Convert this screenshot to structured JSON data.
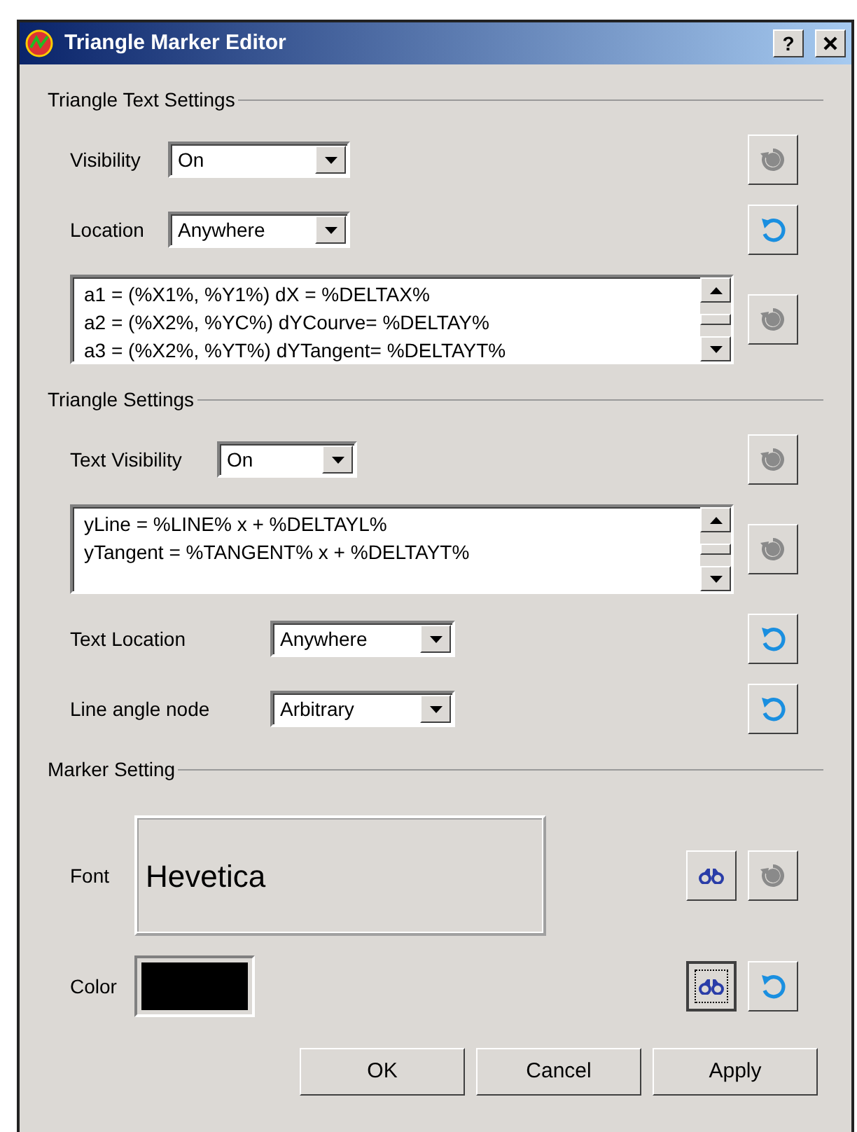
{
  "window": {
    "title": "Triangle Marker Editor",
    "help_label": "?"
  },
  "sections": [
    {
      "title": "Triangle Text Settings",
      "rows": [
        {
          "kind": "select",
          "label": "Visibility",
          "value": "On",
          "reset_disabled": true
        },
        {
          "kind": "select",
          "label": "Location",
          "value": "Anywhere",
          "reset_disabled": false
        },
        {
          "kind": "textarea",
          "lines": [
            "a1 = (%X1%, %Y1%) dX = %DELTAX%",
            "a2 = (%X2%, %YC%) dYCourve= %DELTAY%",
            "a3 = (%X2%, %YT%) dYTangent= %DELTAYT%"
          ],
          "reset_disabled": true
        }
      ]
    },
    {
      "title": "Triangle Settings",
      "rows": [
        {
          "kind": "select",
          "label": "Text Visibility",
          "value": "On",
          "reset_disabled": true
        },
        {
          "kind": "textarea",
          "lines": [
            "yLine = %LINE% x + %DELTAYL%",
            "yTangent = %TANGENT% x + %DELTAYT%"
          ],
          "reset_disabled": true
        },
        {
          "kind": "select",
          "label": "Text Location",
          "value": "Anywhere",
          "reset_disabled": false
        },
        {
          "kind": "select",
          "label": "Line angle node",
          "value": "Arbitrary",
          "reset_disabled": false
        }
      ]
    },
    {
      "title": "Marker Setting",
      "rows": [
        {
          "kind": "font",
          "label": "Font",
          "value": "Hevetica",
          "find_focused": false,
          "reset_disabled": true
        },
        {
          "kind": "color",
          "label": "Color",
          "color": "#000000",
          "find_focused": true,
          "reset_disabled": false
        }
      ]
    }
  ],
  "buttons": [
    "OK",
    "Cancel",
    "Apply"
  ]
}
